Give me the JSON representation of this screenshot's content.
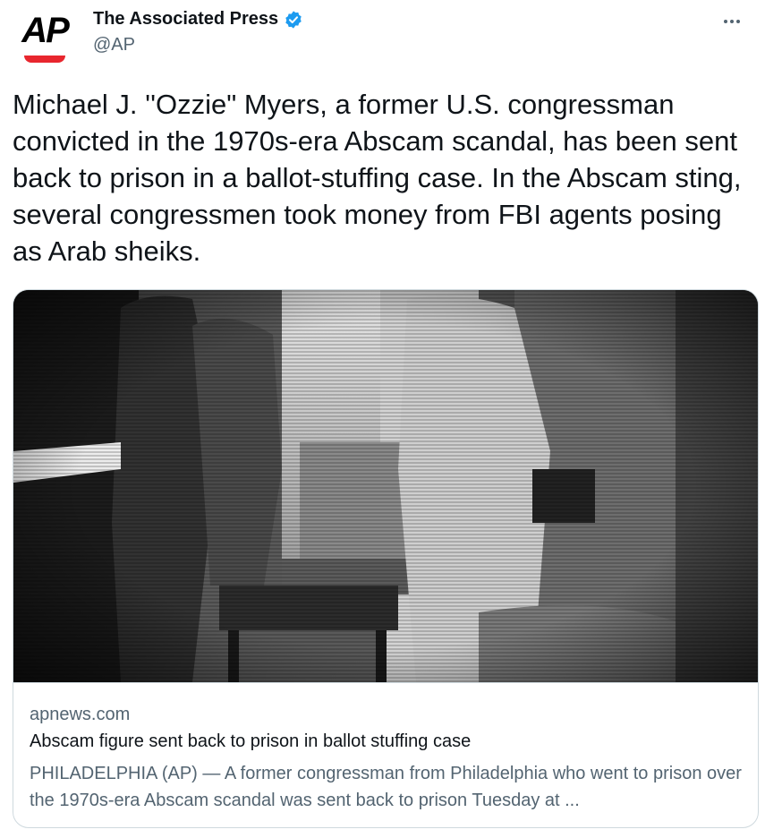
{
  "author": {
    "display_name": "The Associated Press",
    "handle": "@AP",
    "avatar_text": "AP",
    "verified_icon": "verified-badge-icon",
    "brand_color": "#e8262e",
    "verified_color": "#1d9bf0"
  },
  "menu": {
    "icon": "more-horizontal-icon"
  },
  "tweet": {
    "text": "Michael J. ''Ozzie\" Myers, a former U.S. congressman convicted in the 1970s-era Abscam scandal, has been sent back to prison in a ballot-stuffing case. In the Abscam sting, several congressmen took money from FBI agents posing as Arab sheiks."
  },
  "card": {
    "image": "black-and-white surveillance photo",
    "domain": "apnews.com",
    "title": "Abscam figure sent back to prison in ballot stuffing case",
    "description": "PHILADELPHIA (AP) — A former congressman from Philadelphia who went to prison over the 1970s-era Abscam scandal was sent back to prison Tuesday at ..."
  }
}
